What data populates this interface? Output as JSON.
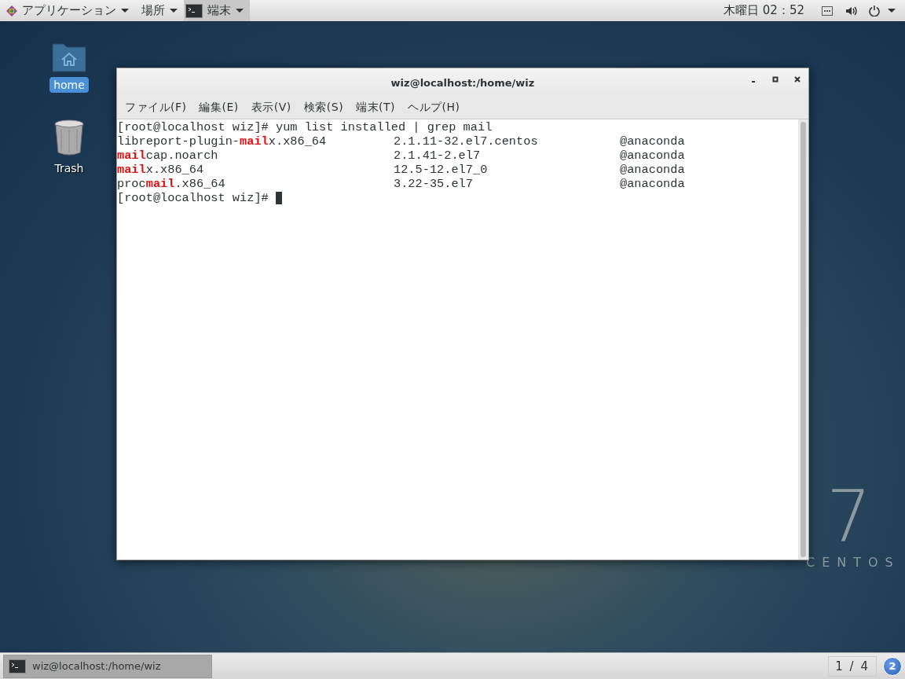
{
  "top_bar": {
    "menus": [
      {
        "label": "アプリケーション",
        "kind": "apps"
      },
      {
        "label": "場所",
        "kind": "plain"
      },
      {
        "label": "端末",
        "kind": "app"
      }
    ],
    "clock": "木曜日 02：52"
  },
  "desktop_icons": [
    {
      "label": "home",
      "kind": "folder",
      "selected": true
    },
    {
      "label": "Trash",
      "kind": "trash",
      "selected": false
    }
  ],
  "wallpaper": {
    "number": "7",
    "name": "CENTOS"
  },
  "window": {
    "title": "wiz@localhost:/home/wiz",
    "menu": [
      "ファイル(F)",
      "編集(E)",
      "表示(V)",
      "検索(S)",
      "端末(T)",
      "ヘルプ(H)"
    ],
    "terminal": {
      "command_line": "[root@localhost wiz]# yum list installed | grep mail",
      "rows": [
        {
          "package": "libreport-plugin-**mail**x.x86_64",
          "version": "2.1.11-32.el7.centos",
          "repo": "@anaconda"
        },
        {
          "package": "**mail**cap.noarch",
          "version": "2.1.41-2.el7",
          "repo": "@anaconda"
        },
        {
          "package": "**mail**x.x86_64",
          "version": "12.5-12.el7_0",
          "repo": "@anaconda"
        },
        {
          "package": "proc**mail**.x86_64",
          "version": "3.22-35.el7",
          "repo": "@anaconda"
        }
      ],
      "prompt": "[root@localhost wiz]#"
    }
  },
  "taskbar": {
    "tasks": [
      {
        "label": "wiz@localhost:/home/wiz",
        "selected": true
      }
    ],
    "workspace": "1 / 4",
    "notifications": "2"
  }
}
